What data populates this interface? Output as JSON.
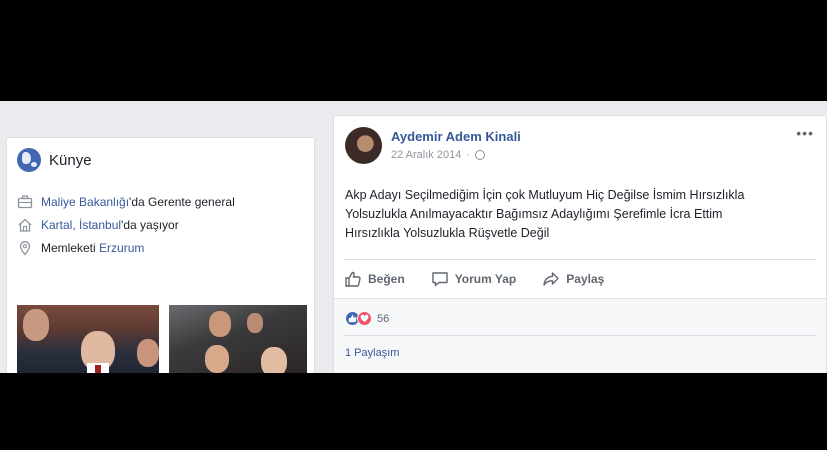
{
  "intro": {
    "title": "Künye",
    "work_link": "Maliye Bakanlığı",
    "work_text": "'da Gerente general",
    "home_link": "Kartal, İstanbul",
    "home_text": "'da yaşıyor",
    "from_text": "Memleketi ",
    "from_link": "Erzurum",
    "icons": {
      "header": "globe-icon",
      "work": "briefcase-icon",
      "home": "house-icon",
      "from": "location-pin-icon"
    }
  },
  "post": {
    "author": "Aydemir Adem Kinali",
    "date": "22 Aralık 2014",
    "separator": "·",
    "more": "•••",
    "text_lines": [
      "Akp Adayı Seçilmediğim İçin çok Mutluyum Hiç Değilse İsmim Hırsızlıkla",
      "Yolsuzlukla Anılmayacaktır Bağımsız Adaylığımı Şerefimle İcra Ettim",
      "Hırsızlıkla Yolsuzlukla Rüşvetle Değil"
    ],
    "actions": {
      "like": "Beğen",
      "comment": "Yorum Yap",
      "share": "Paylaş"
    },
    "reaction_count": "56",
    "shares": "1 Paylaşım"
  },
  "colors": {
    "brand": "#4267b2",
    "link": "#385898",
    "love": "#f25268",
    "background": "#e9ebee"
  }
}
